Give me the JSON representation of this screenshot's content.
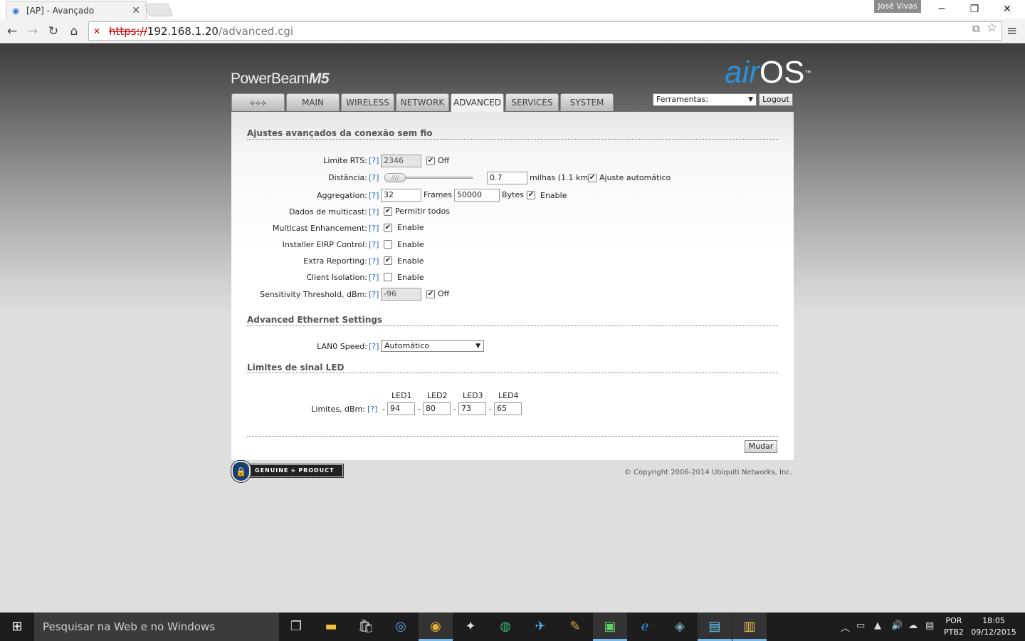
{
  "browser": {
    "tab_title": "[AP] - Avançado",
    "tab_icon": "rss-icon",
    "user": "José Vivas",
    "url": {
      "scheme": "https://",
      "host": "192.168.1.20",
      "path": "/advanced.cgi"
    }
  },
  "header": {
    "brand": "PowerBeam",
    "model": "M5",
    "logo_air": "air",
    "logo_os": "OS",
    "logo_tm": "™"
  },
  "tabs": [
    {
      "label": "",
      "icon": "ubiquiti-logo-icon"
    },
    {
      "label": "MAIN"
    },
    {
      "label": "WIRELESS"
    },
    {
      "label": "NETWORK"
    },
    {
      "label": "ADVANCED",
      "active": true
    },
    {
      "label": "SERVICES"
    },
    {
      "label": "SYSTEM"
    }
  ],
  "tools": {
    "label": "Ferramentas:",
    "logout": "Logout"
  },
  "help": "[?]",
  "wireless": {
    "title": "Ajustes avançados da conexão sem fio",
    "rts": {
      "label": "Limite RTS:",
      "value": "2346",
      "off_label": "Off",
      "off_checked": true
    },
    "distance": {
      "label": "Distância:",
      "value": "0.7",
      "unit": "milhas (1.1 km)",
      "auto_label": "Ajuste automático",
      "auto_checked": true
    },
    "aggregation": {
      "label": "Aggregation:",
      "frames": "32",
      "frames_label": "Frames",
      "bytes": "50000",
      "bytes_label": "Bytes",
      "enable_label": "Enable",
      "enabled": true
    },
    "multicast": {
      "label": "Dados de multicast:",
      "option": "Permitir todos",
      "checked": true
    },
    "multicast_enh": {
      "label": "Multicast Enhancement:",
      "option": "Enable",
      "checked": true
    },
    "eirp": {
      "label": "Installer EIRP Control:",
      "option": "Enable",
      "checked": false
    },
    "extra": {
      "label": "Extra Reporting:",
      "option": "Enable",
      "checked": true
    },
    "isolation": {
      "label": "Client Isolation:",
      "option": "Enable",
      "checked": false
    },
    "sensitivity": {
      "label": "Sensitivity Threshold, dBm:",
      "value": "-96",
      "off_label": "Off",
      "off_checked": true
    }
  },
  "ethernet": {
    "title": "Advanced Ethernet Settings",
    "lan_label": "LAN0 Speed:",
    "lan_value": "Automático"
  },
  "led": {
    "title": "Limites de sinal LED",
    "label": "Limites, dBm:",
    "headers": [
      "LED1",
      "LED2",
      "LED3",
      "LED4"
    ],
    "values": [
      "94",
      "80",
      "73",
      "65"
    ],
    "separator": "-"
  },
  "actions": {
    "save": "Mudar"
  },
  "footer": {
    "badge_left": "GENUINE",
    "badge_right": "PRODUCT",
    "copyright": "© Copyright 2006-2014 Ubiquiti Networks, Inc."
  },
  "taskbar": {
    "search_placeholder": "Pesquisar na Web e no Windows",
    "lang_1": "POR",
    "lang_2": "PTB2",
    "time": "18:05",
    "date": "09/12/2015"
  }
}
